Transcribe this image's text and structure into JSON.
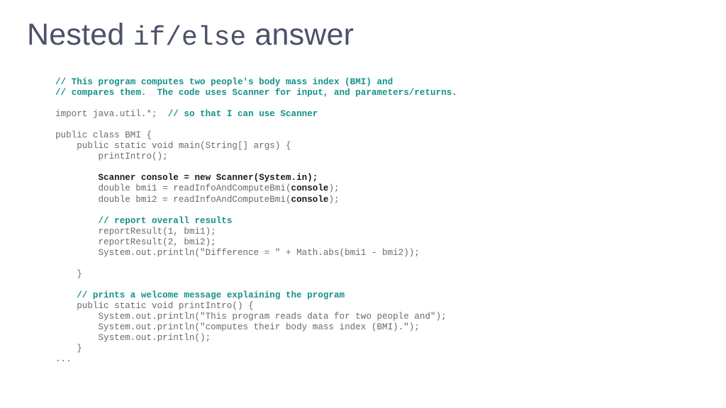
{
  "slide": {
    "title": {
      "prefix": "Nested ",
      "mono": "if/else",
      "suffix": " answer"
    },
    "title_color": "#4b5268",
    "background_color": "#ffffff",
    "code_color": "#6a6a6a",
    "comment_color": "#15918a",
    "emphasis_color": "#1a1a1a",
    "code_lines": [
      {
        "id": "l1",
        "segments": [
          {
            "style": "comment",
            "text": "// This program computes two people's body mass index (BMI) and"
          }
        ]
      },
      {
        "id": "l2",
        "segments": [
          {
            "style": "comment",
            "text": "// compares them.  The code uses Scanner for input, and parameters/returns."
          }
        ]
      },
      {
        "id": "l3",
        "segments": [
          {
            "style": "plain",
            "text": ""
          }
        ]
      },
      {
        "id": "l4",
        "segments": [
          {
            "style": "plain",
            "text": "import java.util.*;  "
          },
          {
            "style": "comment",
            "text": "// so that I can use Scanner"
          }
        ]
      },
      {
        "id": "l5",
        "segments": [
          {
            "style": "plain",
            "text": ""
          }
        ]
      },
      {
        "id": "l6",
        "segments": [
          {
            "style": "plain",
            "text": "public class BMI {"
          }
        ]
      },
      {
        "id": "l7",
        "segments": [
          {
            "style": "plain",
            "text": "    public static void main(String[] args) {"
          }
        ]
      },
      {
        "id": "l8",
        "segments": [
          {
            "style": "plain",
            "text": "        printIntro();"
          }
        ]
      },
      {
        "id": "l9",
        "segments": [
          {
            "style": "plain",
            "text": ""
          }
        ]
      },
      {
        "id": "l10",
        "segments": [
          {
            "style": "plain",
            "text": "        "
          },
          {
            "style": "strong",
            "text": "Scanner console = new Scanner(System.in);"
          }
        ]
      },
      {
        "id": "l11",
        "segments": [
          {
            "style": "plain",
            "text": "        double bmi1 = readInfoAndComputeBmi("
          },
          {
            "style": "strong",
            "text": "console"
          },
          {
            "style": "plain",
            "text": ");"
          }
        ]
      },
      {
        "id": "l12",
        "segments": [
          {
            "style": "plain",
            "text": "        double bmi2 = readInfoAndComputeBmi("
          },
          {
            "style": "strong",
            "text": "console"
          },
          {
            "style": "plain",
            "text": ");"
          }
        ]
      },
      {
        "id": "l13",
        "segments": [
          {
            "style": "plain",
            "text": ""
          }
        ]
      },
      {
        "id": "l14",
        "segments": [
          {
            "style": "plain",
            "text": "        "
          },
          {
            "style": "comment",
            "text": "// report overall results"
          }
        ]
      },
      {
        "id": "l15",
        "segments": [
          {
            "style": "plain",
            "text": "        reportResult(1, bmi1);"
          }
        ]
      },
      {
        "id": "l16",
        "segments": [
          {
            "style": "plain",
            "text": "        reportResult(2, bmi2);"
          }
        ]
      },
      {
        "id": "l17",
        "segments": [
          {
            "style": "plain",
            "text": "        System.out.println(\"Difference = \" + Math.abs(bmi1 - bmi2));"
          }
        ]
      },
      {
        "id": "l18",
        "segments": [
          {
            "style": "plain",
            "text": ""
          }
        ]
      },
      {
        "id": "l19",
        "segments": [
          {
            "style": "plain",
            "text": "    }"
          }
        ]
      },
      {
        "id": "l20",
        "segments": [
          {
            "style": "plain",
            "text": ""
          }
        ]
      },
      {
        "id": "l21",
        "segments": [
          {
            "style": "plain",
            "text": "    "
          },
          {
            "style": "comment",
            "text": "// prints a welcome message explaining the program"
          }
        ]
      },
      {
        "id": "l22",
        "segments": [
          {
            "style": "plain",
            "text": "    public static void printIntro() {"
          }
        ]
      },
      {
        "id": "l23",
        "segments": [
          {
            "style": "plain",
            "text": "        System.out.println(\"This program reads data for two people and\");"
          }
        ]
      },
      {
        "id": "l24",
        "segments": [
          {
            "style": "plain",
            "text": "        System.out.println(\"computes their body mass index (BMI).\");"
          }
        ]
      },
      {
        "id": "l25",
        "segments": [
          {
            "style": "plain",
            "text": "        System.out.println();"
          }
        ]
      },
      {
        "id": "l26",
        "segments": [
          {
            "style": "plain",
            "text": "    }"
          }
        ]
      },
      {
        "id": "l27",
        "segments": [
          {
            "style": "plain",
            "text": "..."
          }
        ]
      }
    ]
  }
}
